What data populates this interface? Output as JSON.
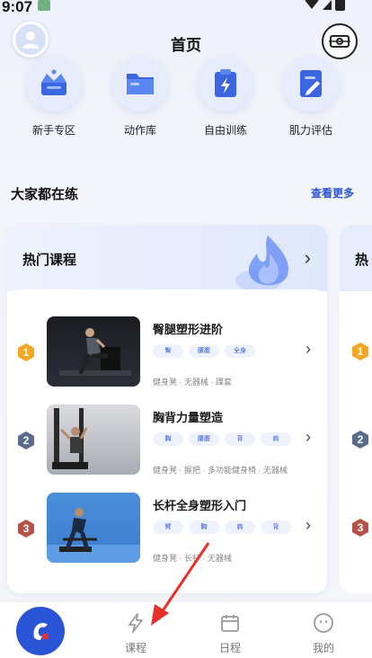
{
  "status_bar": {
    "time": "9:07"
  },
  "header": {
    "title": "首页"
  },
  "quick_entries": [
    {
      "label": "新手专区",
      "icon": "crown-icon"
    },
    {
      "label": "动作库",
      "icon": "folder-icon"
    },
    {
      "label": "自由训练",
      "icon": "bolt-clipboard-icon"
    },
    {
      "label": "肌力评估",
      "icon": "pen-note-icon"
    }
  ],
  "section": {
    "title": "大家都在练",
    "more_label": "查看更多"
  },
  "course_card": {
    "title": "热门课程",
    "items": [
      {
        "rank": "1",
        "name": "臀腿塑形进阶",
        "tags": [
          "臀",
          "腰腹",
          "全身"
        ],
        "equipment": "健身凳 · 无器械 · 踝套"
      },
      {
        "rank": "2",
        "name": "胸背力量塑造",
        "tags": [
          "胸",
          "腰腹",
          "背",
          "肩"
        ],
        "equipment": "健身凳 · 握把 · 多功能健身椅 · 无器械"
      },
      {
        "rank": "3",
        "name": "长杆全身塑形入门",
        "tags": [
          "臂",
          "胸",
          "肩",
          "背"
        ],
        "equipment": "健身凳 · 长杆 · 无器械"
      }
    ]
  },
  "peek_card": {
    "title": "热",
    "ranks": [
      "1",
      "2",
      "3"
    ]
  },
  "bottom_nav": {
    "items": [
      {
        "label": "课程",
        "icon": "bolt-icon"
      },
      {
        "label": "日程",
        "icon": "calendar-icon"
      },
      {
        "label": "我的",
        "icon": "smile-icon"
      }
    ]
  },
  "colors": {
    "accent": "#2a54d6",
    "gold": "#f5a623",
    "slate": "#5b6b8c",
    "red": "#b5524a",
    "annotation": "#e8302b"
  }
}
